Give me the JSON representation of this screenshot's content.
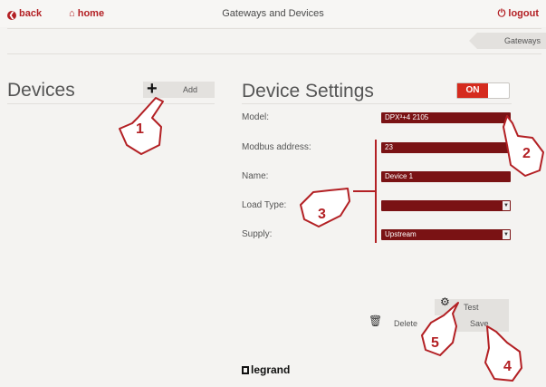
{
  "topbar": {
    "back_label": "back",
    "home_label": "home",
    "title": "Gateways and Devices",
    "logout_label": "logout"
  },
  "breadcrumb": {
    "label": "Gateways"
  },
  "devices": {
    "title": "Devices",
    "add_label": "Add"
  },
  "settings": {
    "title": "Device Settings",
    "toggle_label": "ON",
    "fields": {
      "model": {
        "label": "Model:",
        "value": "DPX³+4 2105"
      },
      "modbus": {
        "label": "Modbus address:",
        "value": "23"
      },
      "name": {
        "label": "Name:",
        "value": "Device 1"
      },
      "load_type": {
        "label": "Load Type:",
        "value": ""
      },
      "supply": {
        "label": "Supply:",
        "value": "Upstream"
      }
    }
  },
  "actions": {
    "test_label": "Test",
    "delete_label": "Delete",
    "save_label": "Save"
  },
  "brand": {
    "logo_text": "legrand"
  },
  "callouts": [
    "1",
    "2",
    "3",
    "4",
    "5"
  ],
  "colors": {
    "accent": "#b32024",
    "field_bg": "#7a1214",
    "toggle_on": "#d52b1e",
    "background": "#f4f3f1"
  }
}
